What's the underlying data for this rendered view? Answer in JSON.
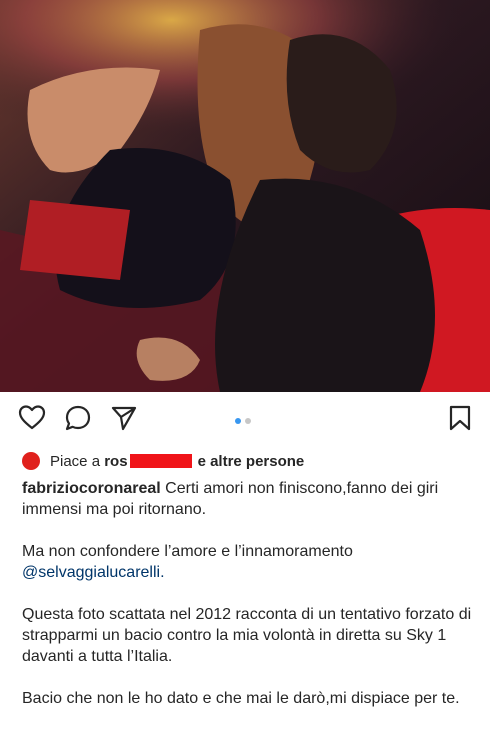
{
  "post": {
    "likes": {
      "prefix": "Piace a",
      "partial_name": "ros",
      "suffix": "e altre persone"
    },
    "caption": {
      "username": "fabriziocoronareal",
      "line1": "Certi amori non finiscono,fanno dei giri immensi ma poi ritornano.",
      "line2": "Ma non confondere l’amore e l’innamoramento",
      "mention": "@selvaggialucarelli.",
      "line3": "Questa foto scattata nel 2012 racconta di un tentativo forzato di strapparmi un bacio contro la mia volontà in diretta su Sky 1 davanti a tutta l’Italia.",
      "line4": "Bacio che non le ho dato e che mai le darò,mi dispiace per te."
    },
    "carousel": {
      "current": 1,
      "total": 2
    }
  },
  "icons": {
    "like": "heart-icon",
    "comment": "comment-icon",
    "share": "paper-plane-icon",
    "save": "bookmark-icon"
  },
  "colors": {
    "active_dot": "#3897f0",
    "redaction": "#f01419",
    "mention": "#003569"
  }
}
